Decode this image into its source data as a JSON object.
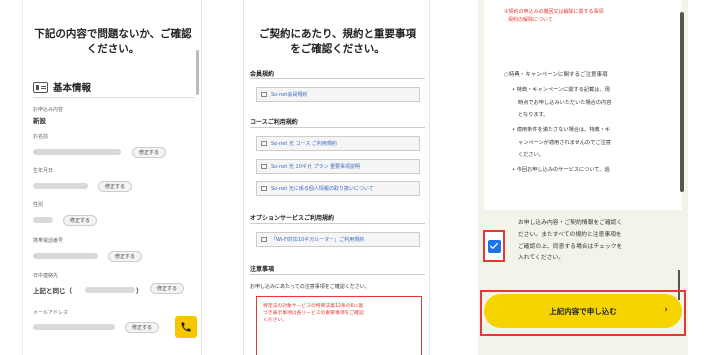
{
  "panel1": {
    "title_line1": "下記の内容で問題ないか、ご確認",
    "title_line2": "ください。",
    "section_title": "基本情報",
    "fields": [
      {
        "label": "お申込み内容",
        "value": "新設"
      },
      {
        "label": "お名前",
        "fix": "修正する"
      },
      {
        "label": "生年月日",
        "fix": "修正する"
      },
      {
        "label": "性別",
        "fix": "修正する"
      },
      {
        "label": "携帯電話番号",
        "fix": "修正する"
      },
      {
        "label": "日中連絡先",
        "value": "上記と同じ（",
        "value_end": "）",
        "fix": "修正する"
      },
      {
        "label": "メールアドレス",
        "fix": "修正する"
      }
    ]
  },
  "panel2": {
    "title_line1": "ご契約にあたり、規約と重要事項",
    "title_line2": "をご確認ください。",
    "section_member": "会員規約",
    "link_member": "So-net会員規約",
    "section_course": "コースご利用規約",
    "link_course1": "So-net 光 コース ご利用規約",
    "link_course2": "So-net 光 10ギガ プラン 重要事項説明",
    "link_course3": "So-net 光に係る個人情報の取り扱いについて",
    "section_option": "オプションサービスご利用規約",
    "link_option": "「Wi-Fi対応10ギガルーター」ご利用規約",
    "section_notice": "注意事項",
    "notice_text": "お申し込みにあたっての注意事項をご確認ください。",
    "red_line1": "特定法の対象サービスの特商法第12条の6に基",
    "red_line2": "づき表示事項は各リービスの重要事項をご確認",
    "red_line3": "ください。"
  },
  "panel3": {
    "red_line1": "③契約の申込みの撤回又は解除に関する事項",
    "red_line2": "契約の解除について",
    "campaign_title": "○特典・キャンペーンに関するご注意事項",
    "bullet1_l1": "特典・キャンペーンに関する記載は、現",
    "bullet1_l2": "時点でお申し込みいただいた場合の内容",
    "bullet1_l3": "となります。",
    "bullet2_l1": "適用条件を満たさない場合は、特典・キ",
    "bullet2_l2": "ャンペーンが適用されませんのでご注意",
    "bullet2_l3": "ください。",
    "bullet3_l1": "今回お申し込みのサービスについて、過",
    "checkbox_checked": true,
    "checkbox_line1": "お申し込み内容・ご契約情報をご確認く",
    "checkbox_line2": "ださい。またすべての規約と注意事項を",
    "checkbox_line3": "ご確認の上、同意する場合はチェックを",
    "checkbox_line4": "入れてください。",
    "submit_label": "上記内容で申し込む",
    "submit_chevron": "›"
  },
  "colors": {
    "accent_yellow": "#f6d400",
    "highlight_red": "#e53935",
    "checkbox_blue": "#1e73e8",
    "link_blue": "#3a6cc4"
  },
  "icons": [
    "profile-card-icon",
    "document-icon",
    "phone-icon",
    "check-icon",
    "chevron-right-icon"
  ]
}
